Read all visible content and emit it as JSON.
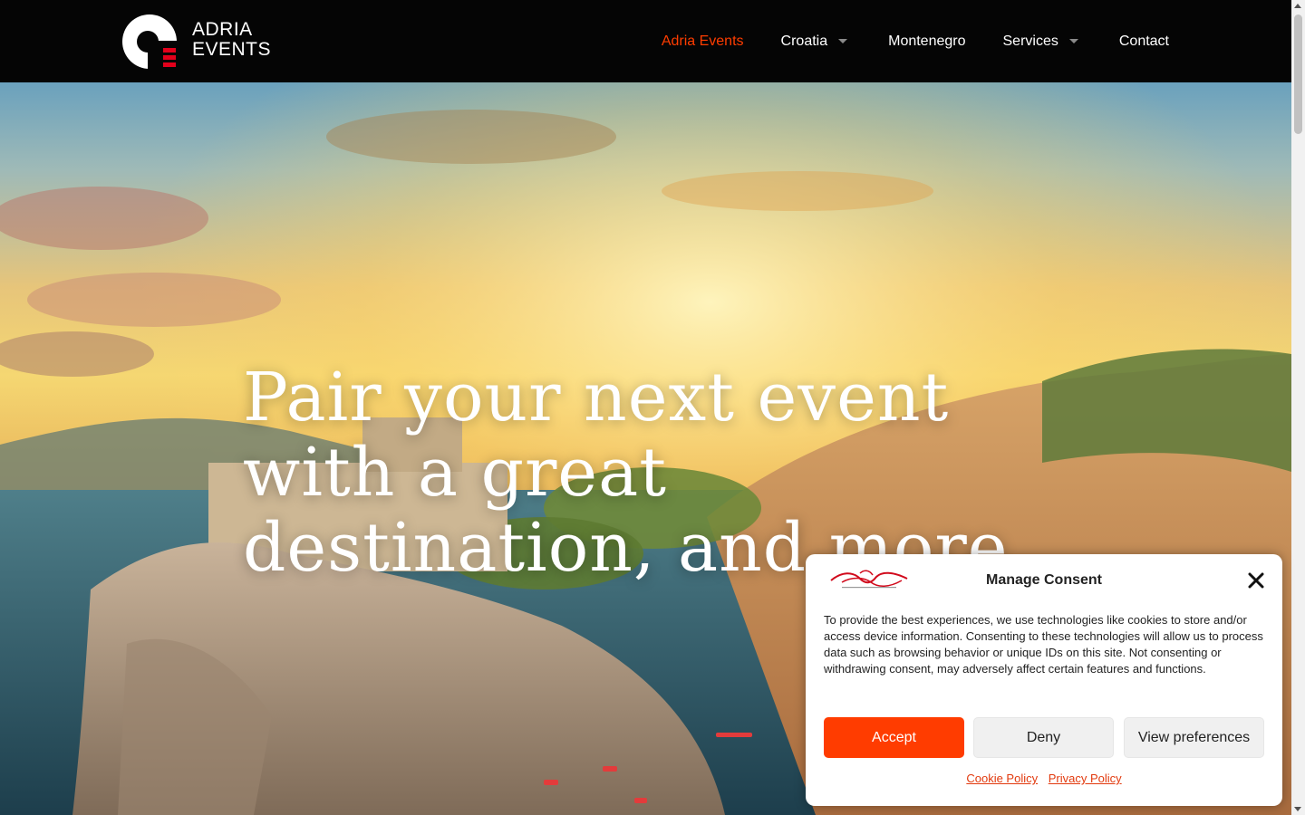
{
  "header": {
    "logo": {
      "line1": "ADRIA",
      "line2": "EVENTS"
    },
    "nav": [
      {
        "label": "Adria Events",
        "active": true,
        "has_dropdown": false
      },
      {
        "label": "Croatia",
        "active": false,
        "has_dropdown": true
      },
      {
        "label": "Montenegro",
        "active": false,
        "has_dropdown": false
      },
      {
        "label": "Services",
        "active": false,
        "has_dropdown": true
      },
      {
        "label": "Contact",
        "active": false,
        "has_dropdown": false
      }
    ]
  },
  "hero": {
    "title": "Pair your next event with a great destination, and more"
  },
  "consent": {
    "title": "Manage Consent",
    "text": "To provide the best experiences, we use technologies like cookies to store and/or access device information. Consenting to these technologies will allow us to process data such as browsing behavior or unique IDs on this site. Not consenting or withdrawing consent, may adversely affect certain features and functions.",
    "accept_label": "Accept",
    "deny_label": "Deny",
    "preferences_label": "View preferences",
    "links": {
      "cookie_policy": "Cookie Policy",
      "privacy_policy": "Privacy Policy"
    }
  },
  "colors": {
    "accent": "#ff3c00",
    "header_bg": "#050505",
    "nav_active": "#ff3d00",
    "link": "#e23a0e"
  }
}
